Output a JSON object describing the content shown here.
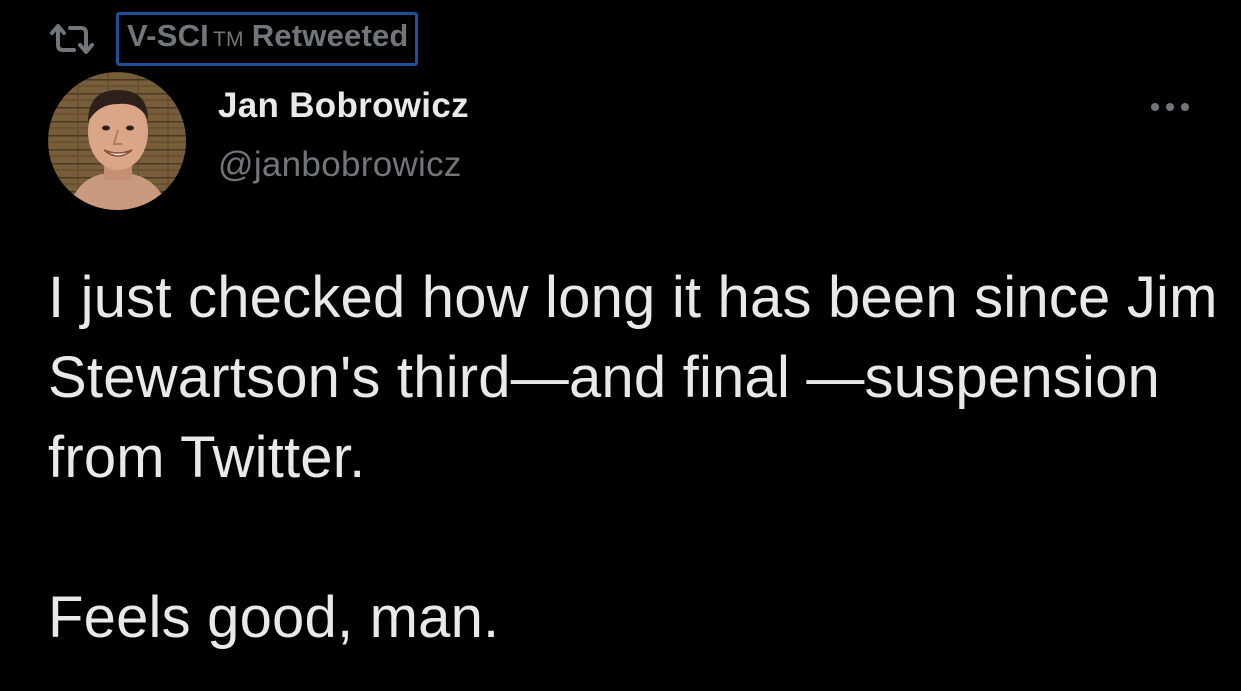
{
  "retweet": {
    "icon": "retweet-icon",
    "account": "V-SCI",
    "trademark": "TM",
    "label": "Retweeted",
    "highlight_color": "#1d4f9a"
  },
  "author": {
    "name": "Jan Bobrowicz",
    "handle": "@janbobrowicz",
    "avatar_icon": "user-avatar"
  },
  "more_icon": "more-options-icon",
  "tweet": {
    "paragraph_1": "I just checked how long it has been since Jim Stewartson's third—and final —suspension from Twitter.",
    "paragraph_2": "Feels good, man."
  },
  "colors": {
    "background": "#000000",
    "primary_text": "#e7e9ea",
    "secondary_text": "#71767b"
  }
}
